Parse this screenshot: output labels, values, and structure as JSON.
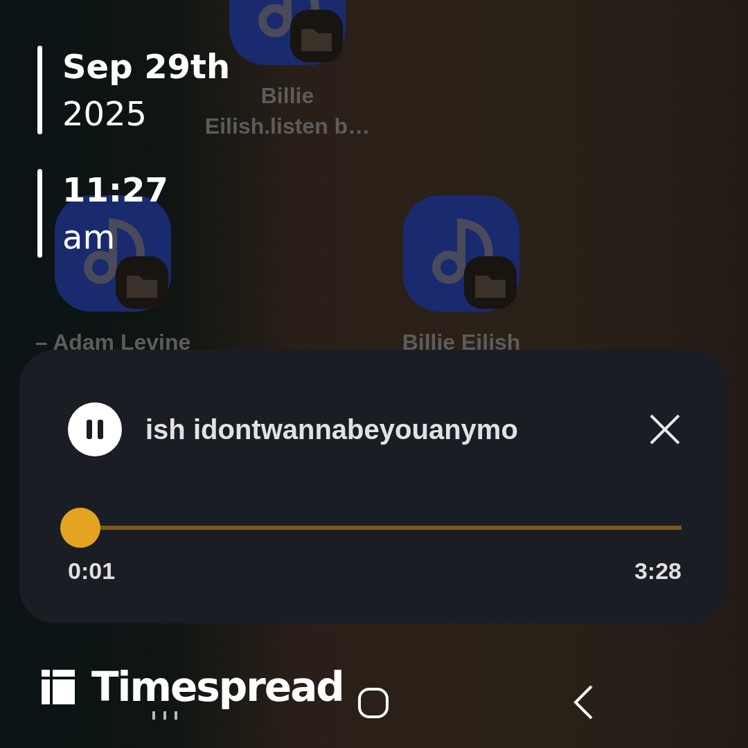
{
  "home_icons": [
    {
      "label_lines": [
        "Billie",
        "Eilish.listen b…"
      ]
    },
    {
      "label_lines": [
        "– Adam Levine"
      ]
    },
    {
      "label_lines": [
        "Billie Eilish"
      ]
    }
  ],
  "stamp": {
    "date": "Sep 29th",
    "year": "2025",
    "time": "11:27",
    "period": "am"
  },
  "player": {
    "title": "ish idontwannabeyouanymo",
    "playing": true,
    "level": 0.0,
    "elapsed": "0:01",
    "duration": "3:28"
  },
  "brand": {
    "name": "Timespread"
  }
}
